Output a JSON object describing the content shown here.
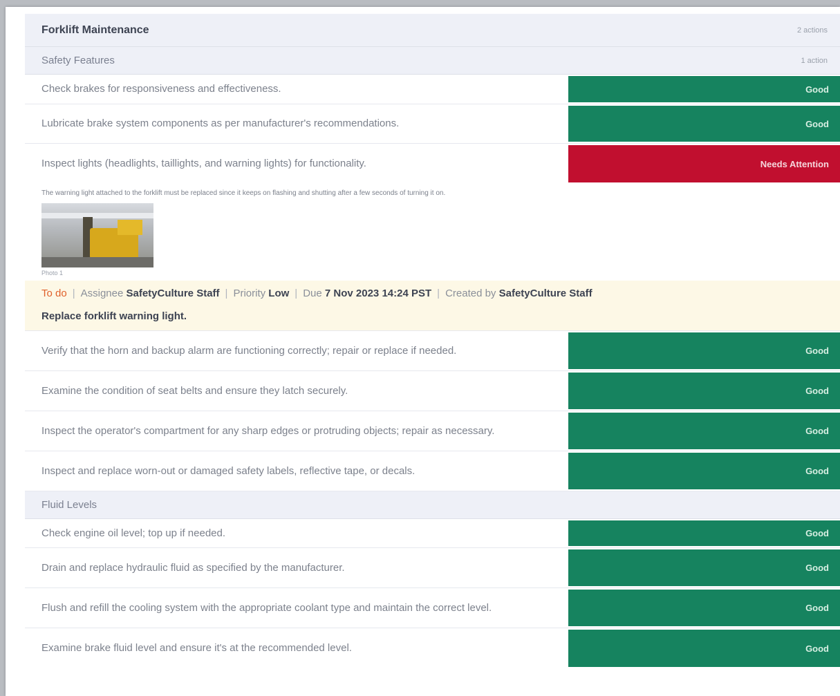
{
  "section": {
    "title": "Forklift Maintenance",
    "count": "2 actions"
  },
  "subsections": [
    {
      "title": "Safety Features",
      "count": "1 action",
      "items": [
        {
          "question": "Check brakes for responsiveness and effectiveness.",
          "answer": "Good"
        },
        {
          "question": "Lubricate brake system components as per manufacturer's recommendations.",
          "answer": "Good"
        },
        {
          "question": "Inspect lights (headlights, taillights, and warning lights) for functionality.",
          "answer": "Needs Attention"
        },
        {
          "question": "Verify that the horn and backup alarm are functioning correctly; repair or replace if needed.",
          "answer": "Good"
        },
        {
          "question": "Examine the condition of seat belts and ensure they latch securely.",
          "answer": "Good"
        },
        {
          "question": "Inspect the operator's compartment for any sharp edges or protruding objects; repair as necessary.",
          "answer": "Good"
        },
        {
          "question": "Inspect and replace worn-out or damaged safety labels, reflective tape, or decals.",
          "answer": "Good"
        }
      ],
      "note": "The warning light attached to the forklift must be replaced since it keeps on flashing and shutting after a few seconds of turning it on.",
      "photo_caption": "Photo 1",
      "action": {
        "status": "To do",
        "assignee_label": "Assignee",
        "assignee": "SafetyCulture Staff",
        "priority_label": "Priority",
        "priority": "Low",
        "due_label": "Due",
        "due": "7 Nov 2023 14:24 PST",
        "created_label": "Created by",
        "created_by": "SafetyCulture Staff",
        "title": "Replace forklift warning light."
      }
    },
    {
      "title": "Fluid Levels",
      "items": [
        {
          "question": "Check engine oil level; top up if needed.",
          "answer": "Good"
        },
        {
          "question": "Drain and replace hydraulic fluid as specified by the manufacturer.",
          "answer": "Good"
        },
        {
          "question": "Flush and refill the cooling system with the appropriate coolant type and maintain the correct level.",
          "answer": "Good"
        },
        {
          "question": "Examine brake fluid level and ensure it's at the recommended level.",
          "answer": "Good"
        }
      ]
    }
  ],
  "colors": {
    "good": "#16835f",
    "needs_attention": "#c10f2f",
    "action_bg": "#fdf8e6",
    "todo": "#e0602a"
  }
}
